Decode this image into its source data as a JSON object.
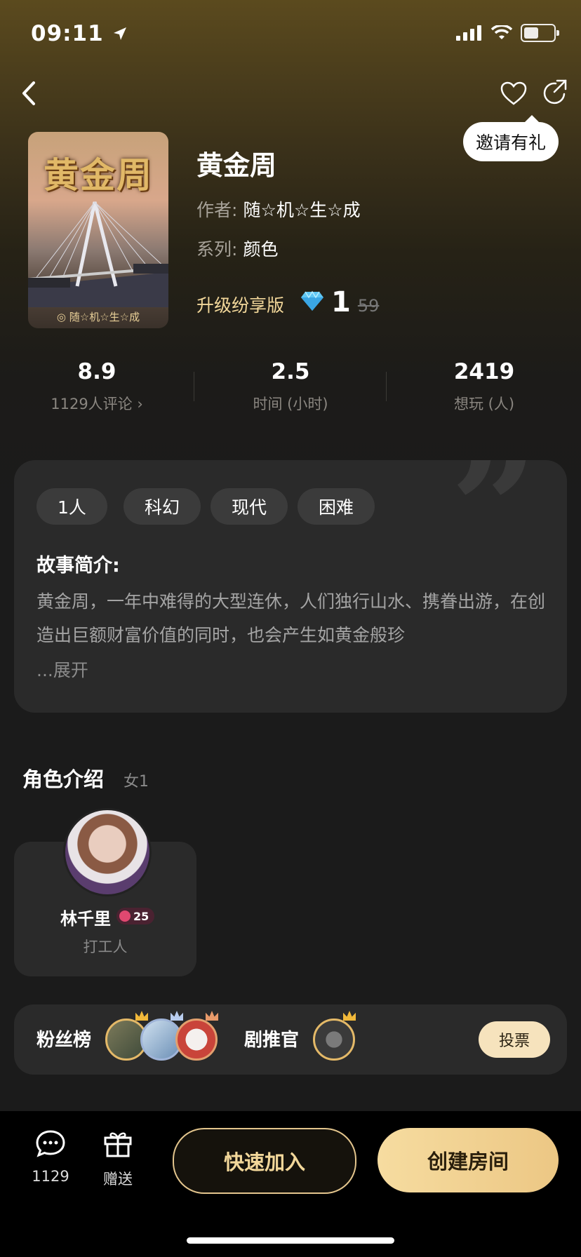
{
  "status": {
    "time": "09:11"
  },
  "header": {
    "invite_tip": "邀请有礼"
  },
  "game": {
    "cover_title": "黄金周",
    "cover_author": "◎ 随☆机☆生☆成",
    "title": "黄金周",
    "author_label": "作者:",
    "author": "随☆机☆生☆成",
    "series_label": "系列:",
    "series": "颜色",
    "upgrade_label": "升级纷享版",
    "price_now": "1",
    "price_old": "59"
  },
  "stats": [
    {
      "value": "8.9",
      "label": "1129人评论 ›"
    },
    {
      "value": "2.5",
      "label": "时间 (小时)"
    },
    {
      "value": "2419",
      "label": "想玩 (人)"
    }
  ],
  "tags": [
    "1人",
    "科幻",
    "现代",
    "困难"
  ],
  "story": {
    "heading": "故事简介:",
    "text": "黄金周，一年中难得的大型连休，人们独行山水、携眷出游，在创造出巨额财富价值的同时，也会产生如黄金般珍",
    "expand": "...展开"
  },
  "roles": {
    "heading": "角色介绍",
    "sub": "女1",
    "items": [
      {
        "name": "林千里",
        "level": "25",
        "job": "打工人"
      }
    ]
  },
  "fans": {
    "label": "粉丝榜",
    "recommender_label": "剧推官",
    "vote": "投票"
  },
  "bottom": {
    "comments_count": "1129",
    "gift_label": "赠送",
    "quick_join": "快速加入",
    "create_room": "创建房间"
  },
  "colors": {
    "accent": "#f2d79a",
    "button_gold": "#ecc784",
    "card_bg": "#2a2a2a"
  }
}
